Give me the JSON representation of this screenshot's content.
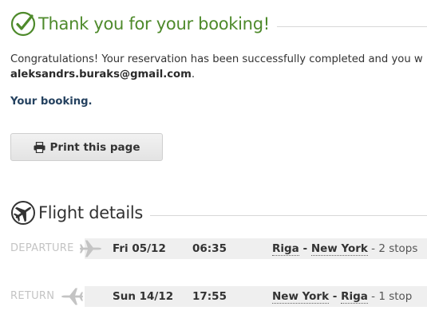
{
  "confirmation": {
    "title": "Thank you for your booking!",
    "message_line1": "Congratulations! Your reservation has been successfully completed and you w",
    "email": "aleksandrs.buraks@gmail.com",
    "email_suffix": ".",
    "your_booking_label": "Your booking.",
    "print_button_label": "Print this page"
  },
  "flight_details": {
    "title": "Flight details",
    "departure": {
      "label": "DEPARTURE",
      "date": "Fri 05/12",
      "time": "06:35",
      "from": "Riga",
      "separator": " - ",
      "to": "New York",
      "stops": " - 2 stops"
    },
    "return": {
      "label": "RETURN",
      "date": "Sun 14/12",
      "time": "17:55",
      "from": "New York",
      "separator": " - ",
      "to": "Riga",
      "stops": " - 1 stop"
    }
  },
  "colors": {
    "accent_green": "#4e8a2b",
    "navy_text": "#24415f",
    "row_band": "#efefef",
    "muted_label": "#c4c4c4"
  },
  "icons": {
    "confirmation": "check-circle-icon",
    "flight_section": "plane-circle-icon",
    "print": "printer-icon",
    "departure": "plane-departure-icon",
    "return": "plane-return-icon"
  }
}
